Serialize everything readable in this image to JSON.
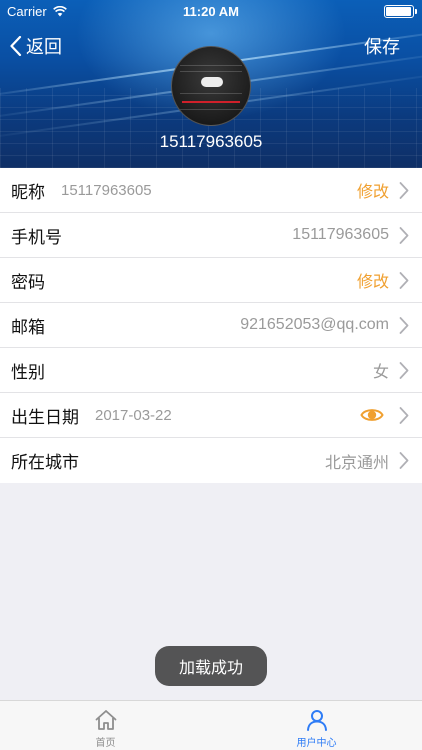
{
  "status_bar": {
    "carrier": "Carrier",
    "time": "11:20 AM",
    "battery_level": 0.95
  },
  "nav": {
    "back_label": "返回",
    "save_label": "保存"
  },
  "profile": {
    "phone": "15117963605"
  },
  "rows": [
    {
      "label": "昵称",
      "sub": "15117963605",
      "value": "修改"
    },
    {
      "label": "手机号",
      "value": "15117963605"
    },
    {
      "label": "密码",
      "value": "修改"
    },
    {
      "label": "邮箱",
      "value": "921652053@qq.com"
    },
    {
      "label": "性别",
      "value": "女"
    },
    {
      "label": "出生日期",
      "sub": "2017-03-22"
    },
    {
      "label": "所在城市",
      "value": "北京通州"
    }
  ],
  "toast": "加载成功",
  "tabs": [
    {
      "label": "首页",
      "icon": "home-icon"
    },
    {
      "label": "用户中心",
      "icon": "user-icon"
    }
  ],
  "colors": {
    "accent": "#2e7cf6",
    "highlight": "#f0a030",
    "header": "#0b4fa3"
  }
}
